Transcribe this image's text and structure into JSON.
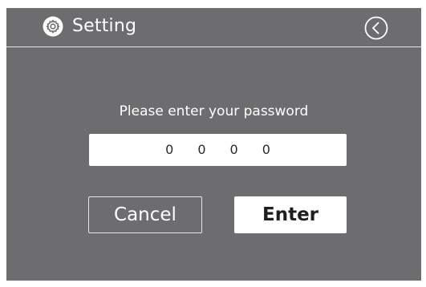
{
  "header": {
    "title": "Setting",
    "settings_icon": "gear-icon",
    "back_icon": "chevron-left-circle-icon"
  },
  "colors": {
    "background": "#6d6c6f",
    "text": "#ffffff",
    "field": "#ffffff"
  },
  "main": {
    "prompt": "Please enter your password",
    "password_digits": [
      "0",
      "0",
      "0",
      "0"
    ],
    "cancel_label": "Cancel",
    "enter_label": "Enter"
  }
}
